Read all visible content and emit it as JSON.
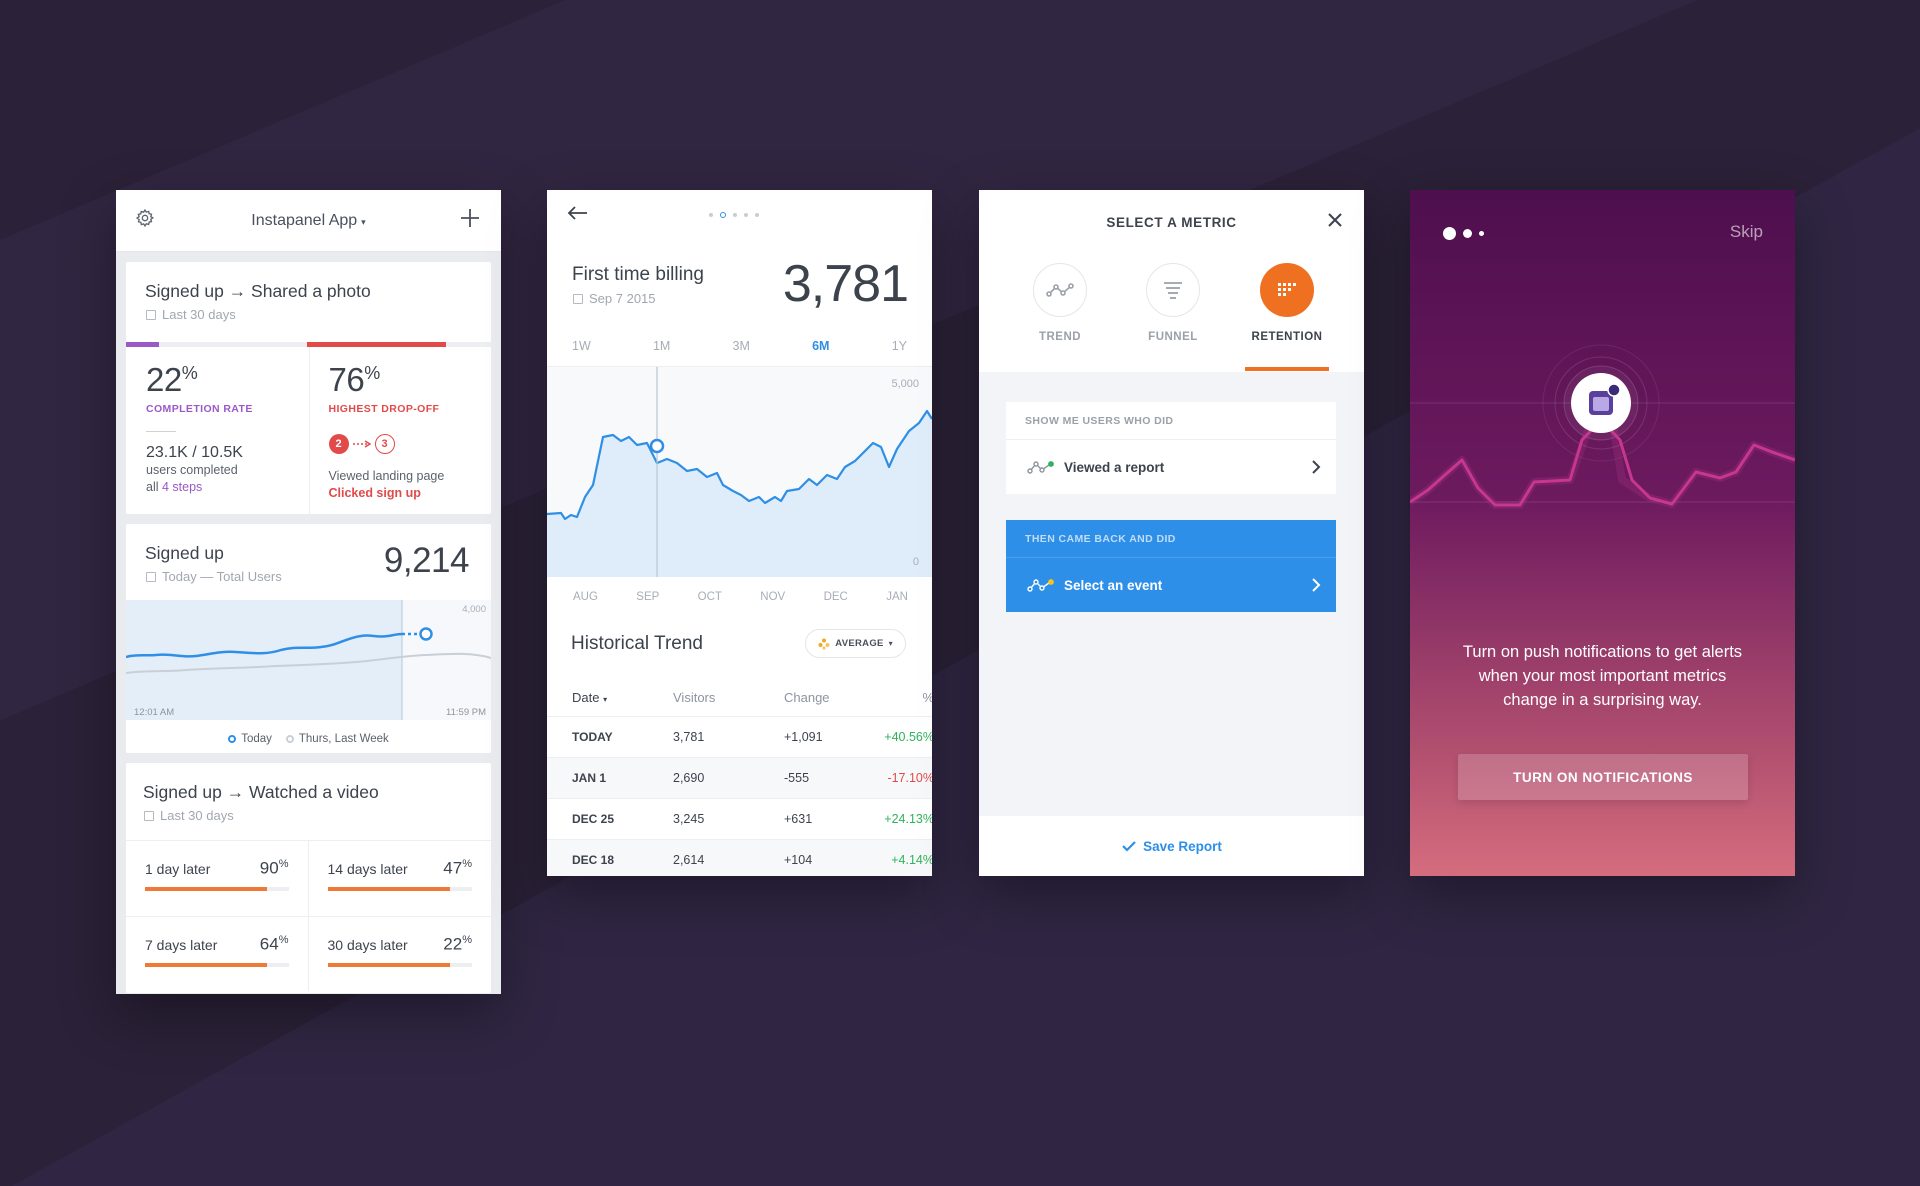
{
  "colors": {
    "accent_blue": "#2f8fe6",
    "accent_orange": "#ee7a37",
    "accent_purple": "#9b59c7",
    "accent_red": "#e24a4a",
    "positive_green": "#2fb35c",
    "negative_red": "#e24a4a"
  },
  "screen1": {
    "header": {
      "title": "Instapanel App",
      "caret": "▾"
    },
    "card1": {
      "title": "Signed up → Shared a photo",
      "subtitle": "Last 30 days",
      "completion_progress": 0.09,
      "dropoff_progress": 0.38,
      "left": {
        "pct": "22",
        "pct_sign": "%",
        "label": "COMPLETION RATE",
        "counts": "23.1K / 10.5K",
        "line1": "users completed",
        "line2_prefix": "all ",
        "line2_link": "4 steps"
      },
      "right": {
        "pct": "76",
        "pct_sign": "%",
        "label": "HIGHEST DROP-OFF",
        "step_from": "2",
        "step_to": "3",
        "line1": "Viewed landing page",
        "line2": "Clicked sign up"
      }
    },
    "card2": {
      "title": "Signed up",
      "subtitle": "Today — Total Users",
      "value": "9,214",
      "y_max_label": "4,000",
      "x_start": "12:01 AM",
      "x_end": "11:59 PM",
      "legend_today": "Today",
      "legend_last": "Thurs, Last Week"
    },
    "card3": {
      "title": "Signed up → Watched a video",
      "subtitle": "Last 30 days",
      "items": [
        {
          "label": "1 day later",
          "value": "90",
          "sign": "%",
          "fill": 0.85
        },
        {
          "label": "14 days later",
          "value": "47",
          "sign": "%",
          "fill": 0.85
        },
        {
          "label": "7 days later",
          "value": "64",
          "sign": "%",
          "fill": 0.85
        },
        {
          "label": "30 days later",
          "value": "22",
          "sign": "%",
          "fill": 0.85
        }
      ]
    }
  },
  "screen2": {
    "title": "First time billing",
    "date": "Sep 7 2015",
    "value": "3,781",
    "ranges": [
      "1W",
      "1M",
      "3M",
      "6M",
      "1Y"
    ],
    "active_range": "6M",
    "y_max": "5,000",
    "y_min": "0",
    "months": [
      "AUG",
      "SEP",
      "OCT",
      "NOV",
      "DEC",
      "JAN"
    ],
    "history_title": "Historical Trend",
    "average_label": "AVERAGE",
    "table": {
      "headers": [
        "Date",
        "Visitors",
        "Change",
        "%"
      ],
      "rows": [
        {
          "date": "TODAY",
          "visitors": "3,781",
          "change": "+1,091",
          "pct": "+40.56%",
          "dir": "pos"
        },
        {
          "date": "JAN 1",
          "visitors": "2,690",
          "change": "-555",
          "pct": "-17.10%",
          "dir": "neg"
        },
        {
          "date": "DEC 25",
          "visitors": "3,245",
          "change": "+631",
          "pct": "+24.13%",
          "dir": "pos"
        },
        {
          "date": "DEC 18",
          "visitors": "2,614",
          "change": "+104",
          "pct": "+4.14%",
          "dir": "pos"
        }
      ]
    }
  },
  "screen3": {
    "title": "SELECT A METRIC",
    "metrics": [
      {
        "label": "TREND",
        "icon": "trend-icon"
      },
      {
        "label": "FUNNEL",
        "icon": "funnel-icon"
      },
      {
        "label": "RETENTION",
        "icon": "retention-grid-icon"
      }
    ],
    "active_metric": "RETENTION",
    "box1": {
      "header": "SHOW ME USERS WHO DID",
      "item": "Viewed a report"
    },
    "box2": {
      "header": "THEN CAME BACK AND DID",
      "item": "Select an event"
    },
    "save_label": "Save Report"
  },
  "screen4": {
    "skip": "Skip",
    "message": "Turn on push notifications to get alerts when your most important metrics change in a surprising way.",
    "button": "TURN ON NOTIFICATIONS"
  }
}
